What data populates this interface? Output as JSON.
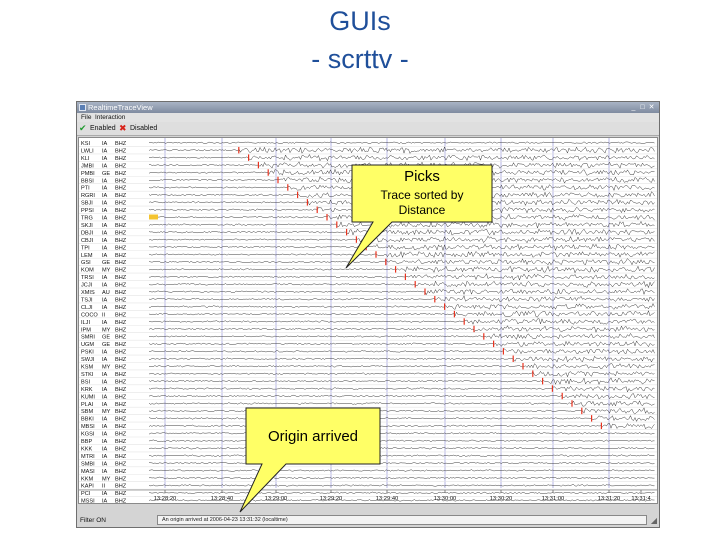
{
  "slide": {
    "title_line1": "GUIs",
    "title_line2": "- scrttv -"
  },
  "window": {
    "title": "RealtimeTraceView",
    "menu": [
      "File",
      "Interaction"
    ],
    "toolbar": {
      "enabled_label": "Enabled",
      "disabled_label": "Disabled"
    },
    "title_buttons": [
      "_",
      "□",
      "✕"
    ]
  },
  "stations": [
    {
      "code": "KSI",
      "net": "IA",
      "cha": "BHZ"
    },
    {
      "code": "LWLI",
      "net": "IA",
      "cha": "BHZ"
    },
    {
      "code": "KLI",
      "net": "IA",
      "cha": "BHZ"
    },
    {
      "code": "JMBI",
      "net": "IA",
      "cha": "BHZ"
    },
    {
      "code": "PMBI",
      "net": "GE",
      "cha": "BHZ"
    },
    {
      "code": "BBSI",
      "net": "IA",
      "cha": "BHZ"
    },
    {
      "code": "PTI",
      "net": "IA",
      "cha": "BHZ"
    },
    {
      "code": "RGRI",
      "net": "IA",
      "cha": "BHZ"
    },
    {
      "code": "SBJI",
      "net": "IA",
      "cha": "BHZ"
    },
    {
      "code": "PPSI",
      "net": "IA",
      "cha": "BHZ"
    },
    {
      "code": "TRG",
      "net": "IA",
      "cha": "BHZ"
    },
    {
      "code": "SKJI",
      "net": "IA",
      "cha": "BHZ"
    },
    {
      "code": "DBJI",
      "net": "IA",
      "cha": "BHZ"
    },
    {
      "code": "CBJI",
      "net": "IA",
      "cha": "BHZ"
    },
    {
      "code": "TPI",
      "net": "IA",
      "cha": "BHZ"
    },
    {
      "code": "LEM",
      "net": "IA",
      "cha": "BHZ"
    },
    {
      "code": "GSI",
      "net": "GE",
      "cha": "BHZ"
    },
    {
      "code": "KOM",
      "net": "MY",
      "cha": "BHZ"
    },
    {
      "code": "TRSI",
      "net": "IA",
      "cha": "BHZ"
    },
    {
      "code": "JCJI",
      "net": "IA",
      "cha": "BHZ"
    },
    {
      "code": "XMIS",
      "net": "AU",
      "cha": "BHZ"
    },
    {
      "code": "TSJI",
      "net": "IA",
      "cha": "BHZ"
    },
    {
      "code": "CLJI",
      "net": "IA",
      "cha": "BHZ"
    },
    {
      "code": "COCO",
      "net": "II",
      "cha": "BHZ"
    },
    {
      "code": "ILJI",
      "net": "IA",
      "cha": "BHZ"
    },
    {
      "code": "IPM",
      "net": "MY",
      "cha": "BHZ"
    },
    {
      "code": "SMRI",
      "net": "GE",
      "cha": "BHZ"
    },
    {
      "code": "UGM",
      "net": "GE",
      "cha": "BHZ"
    },
    {
      "code": "PSKI",
      "net": "IA",
      "cha": "BHZ"
    },
    {
      "code": "SWJI",
      "net": "IA",
      "cha": "BHZ"
    },
    {
      "code": "KSM",
      "net": "MY",
      "cha": "BHZ"
    },
    {
      "code": "STKI",
      "net": "IA",
      "cha": "BHZ"
    },
    {
      "code": "BSI",
      "net": "IA",
      "cha": "BHZ"
    },
    {
      "code": "KRK",
      "net": "IA",
      "cha": "BHZ"
    },
    {
      "code": "KUMI",
      "net": "IA",
      "cha": "BHZ"
    },
    {
      "code": "PLAI",
      "net": "IA",
      "cha": "BHZ"
    },
    {
      "code": "SBM",
      "net": "MY",
      "cha": "BHZ"
    },
    {
      "code": "BBKI",
      "net": "IA",
      "cha": "BHZ"
    },
    {
      "code": "MBSI",
      "net": "IA",
      "cha": "BHZ"
    },
    {
      "code": "KGSI",
      "net": "IA",
      "cha": "BHZ"
    },
    {
      "code": "BBP",
      "net": "IA",
      "cha": "BHZ"
    },
    {
      "code": "KKK",
      "net": "IA",
      "cha": "BHZ"
    },
    {
      "code": "MTRI",
      "net": "IA",
      "cha": "BHZ"
    },
    {
      "code": "SMBI",
      "net": "IA",
      "cha": "BHZ"
    },
    {
      "code": "MASI",
      "net": "IA",
      "cha": "BHZ"
    },
    {
      "code": "KKM",
      "net": "MY",
      "cha": "BHZ"
    },
    {
      "code": "KAPI",
      "net": "II",
      "cha": "BHZ"
    },
    {
      "code": "PCI",
      "net": "IA",
      "cha": "BHZ"
    },
    {
      "code": "MSSI",
      "net": "IA",
      "cha": "BHZ"
    }
  ],
  "picks_rows": [
    1,
    2,
    3,
    4,
    5,
    6,
    7,
    8,
    9,
    10,
    11,
    12,
    13,
    14,
    15,
    16,
    17,
    18,
    19,
    20,
    21,
    22,
    23,
    24,
    25,
    26,
    27,
    28,
    29,
    30,
    31,
    32,
    33,
    34,
    35,
    36,
    37,
    38
  ],
  "time_axis": {
    "labels": [
      "13:28:20",
      "13:28:40",
      "13:29:00",
      "13:29:20",
      "13:29:40",
      "13:30:00",
      "13:30:20",
      "13:31:00",
      "13:31:20",
      "13:31:4"
    ]
  },
  "status": {
    "filter_label": "Filter ON",
    "message": "An origin arrived at 2006-04-23 13:31:32 (localtime)"
  },
  "callouts": {
    "picks_title": "Picks",
    "picks_sub1": "Trace sorted by",
    "picks_sub2": "Distance",
    "origin": "Origin arrived"
  },
  "colors": {
    "pick": "#e8321e",
    "trace": "#3c3c3c",
    "grid": "#b4b4e6",
    "callout_fill": "#ffff66",
    "title": "#1f4f9a"
  }
}
